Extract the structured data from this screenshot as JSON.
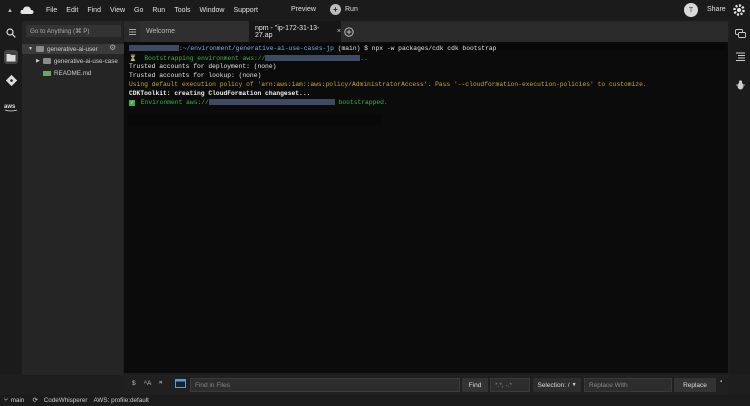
{
  "menu": {
    "items": [
      "File",
      "Edit",
      "Find",
      "View",
      "Go",
      "Run",
      "Tools",
      "Window",
      "Support"
    ],
    "preview": "Preview",
    "run": "Run",
    "avatar_initial": "T",
    "share": "Share"
  },
  "sidebar": {
    "goto_placeholder": "Go to Anything (⌘ P)",
    "tree": [
      {
        "label": "generative-ai-user"
      },
      {
        "label": "generative-ai-use-case"
      },
      {
        "label": "README.md"
      }
    ]
  },
  "tabs": [
    {
      "label": "Welcome"
    },
    {
      "label": "npm - \"ip-172-31-13-27.ap",
      "close": "×"
    }
  ],
  "terminal": {
    "line1_path": ":~/environment/generative-ai-use-cases-jp",
    "line1_rest": " (main) $ npx -w packages/cdk cdk bootstrap",
    "line2": "⏳  Bootstrapping environment aws://",
    "line2_end": "..",
    "line3": "Trusted accounts for deployment: (none)",
    "line4": "Trusted accounts for lookup: (none)",
    "line5": "Using default execution policy of 'arn:aws:iam::aws:policy/AdministratorAccess'. Pass '--cloudformation-execution-policies' to customize.",
    "line6": "CDKToolkit: creating CloudFormation changeset...",
    "line7_a": " Environment aws://",
    "line7_b": " bootstrapped."
  },
  "findbar": {
    "find_placeholder": "Find in Files",
    "find_button": "Find",
    "pattern": "*.*, -.*",
    "selection": "Selection: /",
    "replace_placeholder": "Replace With",
    "replace_button": "Replace"
  },
  "status": {
    "branch": "main",
    "codewhisperer": "CodeWhisperer",
    "profile": "AWS: profile:default"
  }
}
